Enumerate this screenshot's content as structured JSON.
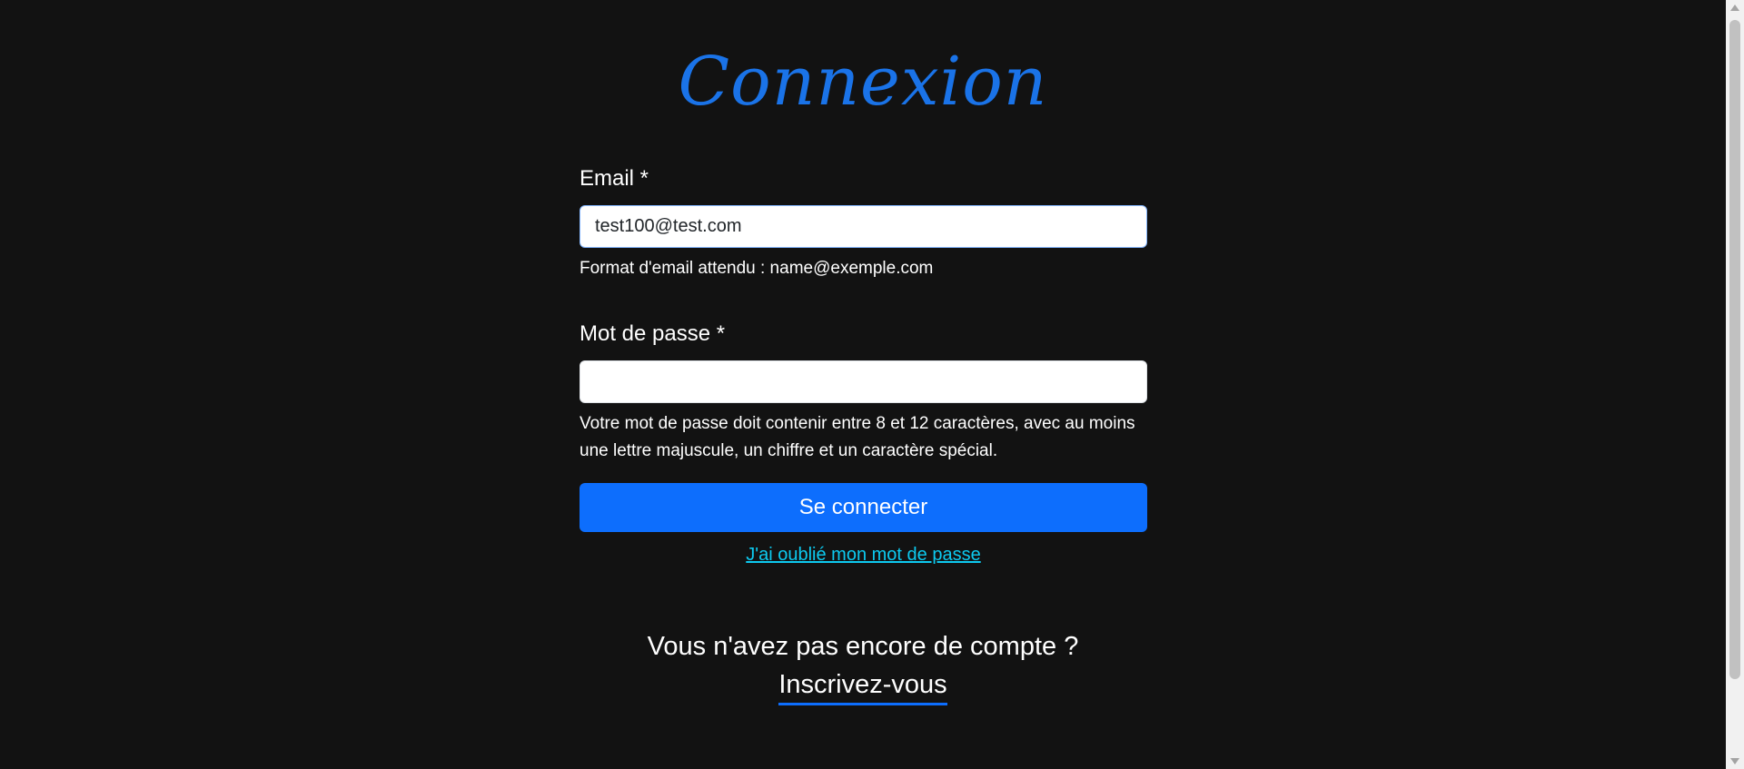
{
  "page": {
    "title": "Connexion"
  },
  "form": {
    "email_label": "Email *",
    "email_value": "test100@test.com",
    "email_help": "Format d'email attendu : name@exemple.com",
    "password_label": "Mot de passe *",
    "password_value": "",
    "password_help": "Votre mot de passe doit contenir entre 8 et 12 caractères, avec au moins une lettre majuscule, un chiffre et un caractère spécial.",
    "submit_label": "Se connecter",
    "forgot_label": "J'ai oublié mon mot de passe"
  },
  "signup": {
    "question": "Vous n'avez pas encore de compte ?",
    "link_label": "Inscrivez-vous"
  },
  "colors": {
    "background": "#121212",
    "title": "#1a73e8",
    "primary_button": "#0d6efd",
    "link": "#0dcaf0",
    "signup_underline": "#0d6efd"
  },
  "icons": {
    "scroll_up": "scroll-up-arrow-icon",
    "scroll_down": "scroll-down-arrow-icon"
  }
}
